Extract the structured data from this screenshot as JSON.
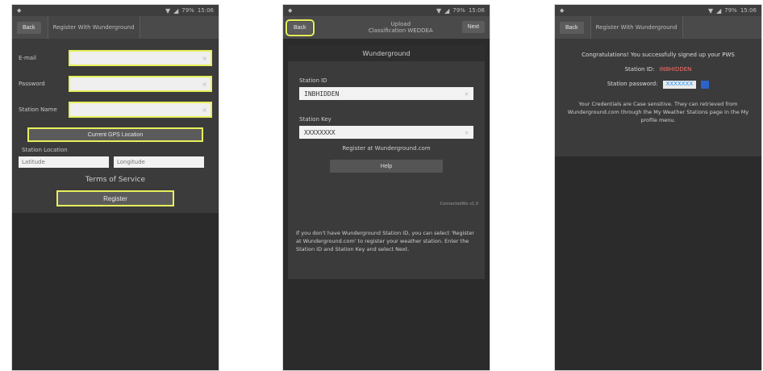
{
  "phone1": {
    "status_time": "15:06",
    "status_battery": "79%",
    "back_label": "Back",
    "title": "Register With Wunderground",
    "fields": [
      {
        "label": "E-mail",
        "value": ""
      },
      {
        "label": "Password",
        "value": ""
      },
      {
        "label": "Station Name",
        "value": ""
      }
    ],
    "gps_button": "Current GPS Location",
    "station_location_label": "Station Location",
    "lat_placeholder": "Latitude",
    "lon_placeholder": "Longitude",
    "terms_label": "Terms of Service",
    "register_label": "Register"
  },
  "phone2": {
    "status_time": "15:06",
    "status_battery": "79%",
    "back_label": "Back",
    "title_line1": "Upload",
    "title_line2": "Classification WEDDEA",
    "next_label": "Next",
    "panel_header": "Wunderground",
    "station_id_label": "Station ID",
    "station_id_value": "INBHIDDEN",
    "station_key_label": "Station Key",
    "station_key_value": "XXXXXXXX",
    "register_link": "Register at Wunderground.com",
    "help_button": "Help",
    "version": "ConnectedWx v1.0",
    "help_text": "If you don't have Wunderground Station ID, you can select 'Register at Wunderground.com' to register your weather station.\nEnter the Station ID and Station Key and select Next."
  },
  "phone3": {
    "status_time": "15:06",
    "status_battery": "79%",
    "back_label": "Back",
    "title": "Register With Wunderground",
    "congrats": "Congratulations! You successfully signed up your PWS",
    "station_id_label": "Station ID:",
    "station_id_value": "INBHIDDEN",
    "station_pw_label": "Station password:",
    "station_pw_value": "XXXXXXX",
    "note": "Your Credentials are Case sensitive. They can retrieved from Wunderground.com through the My Weather Stations page in the My profile menu."
  }
}
